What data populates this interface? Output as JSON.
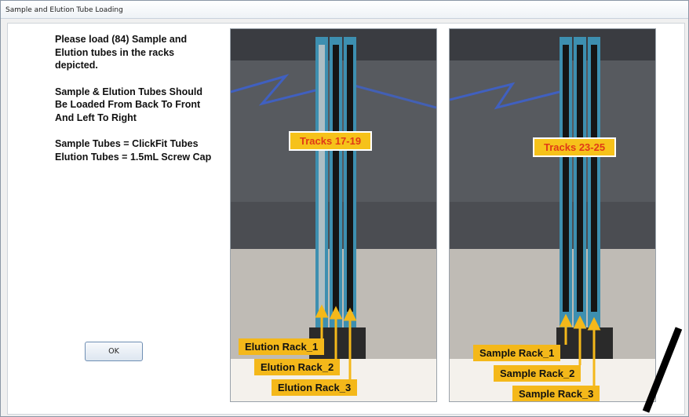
{
  "window": {
    "title": "Sample and Elution Tube Loading"
  },
  "instructions": {
    "p1": [
      "Please load (84) Sample and",
      "Elution tubes in the racks",
      "depicted."
    ],
    "p2": [
      "Sample & Elution Tubes Should",
      "Be Loaded From Back To Front",
      "And Left To Right"
    ],
    "p3": [
      "Sample Tubes = ClickFit Tubes",
      "Elution Tubes = 1.5mL Screw Cap"
    ]
  },
  "buttons": {
    "ok_label": "OK"
  },
  "photo_left": {
    "track_label": "Tracks 17-19",
    "racks": [
      "Elution Rack_1",
      "Elution Rack_2",
      "Elution Rack_3"
    ]
  },
  "photo_right": {
    "track_label": "Tracks 23-25",
    "racks": [
      "Sample Rack_1",
      "Sample Rack_2",
      "Sample Rack_3"
    ]
  },
  "colors": {
    "label_fill": "#f6c21a",
    "track_text": "#e03a16",
    "rack_blue": "#3d8fb0"
  }
}
